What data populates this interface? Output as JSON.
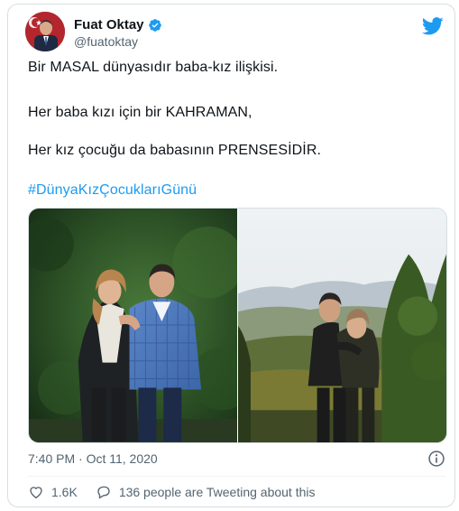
{
  "tweet": {
    "author_name": "Fuat Oktay",
    "author_handle": "@fuatoktay",
    "lines": [
      "Bir MASAL dünyasıdır baba-kız ilişkisi.",
      "Her baba kızı için bir KAHRAMAN,",
      "Her kız çocuğu da babasının PRENSESİDİR."
    ],
    "hashtag": "#DünyaKızÇocuklarıGünü",
    "timestamp": "7:40 PM · Oct 11, 2020",
    "likes": "1.6K",
    "tweeting_about": "136 people are Tweeting about this"
  },
  "icons": {
    "brand": "twitter-bird-icon",
    "verified": "verified-badge-icon",
    "info": "info-icon",
    "like": "heart-icon",
    "reply": "speech-bubble-icon"
  },
  "colors": {
    "accent": "#1d9bf0",
    "text": "#0f1419",
    "secondary": "#536471",
    "border": "#d6dee3"
  }
}
